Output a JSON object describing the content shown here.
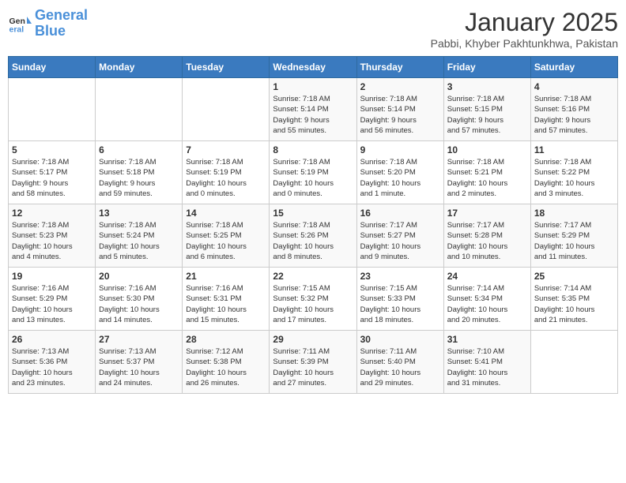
{
  "header": {
    "logo_line1": "General",
    "logo_line2": "Blue",
    "title": "January 2025",
    "subtitle": "Pabbi, Khyber Pakhtunkhwa, Pakistan"
  },
  "weekdays": [
    "Sunday",
    "Monday",
    "Tuesday",
    "Wednesday",
    "Thursday",
    "Friday",
    "Saturday"
  ],
  "weeks": [
    [
      {
        "day": "",
        "detail": ""
      },
      {
        "day": "",
        "detail": ""
      },
      {
        "day": "",
        "detail": ""
      },
      {
        "day": "1",
        "detail": "Sunrise: 7:18 AM\nSunset: 5:14 PM\nDaylight: 9 hours\nand 55 minutes."
      },
      {
        "day": "2",
        "detail": "Sunrise: 7:18 AM\nSunset: 5:14 PM\nDaylight: 9 hours\nand 56 minutes."
      },
      {
        "day": "3",
        "detail": "Sunrise: 7:18 AM\nSunset: 5:15 PM\nDaylight: 9 hours\nand 57 minutes."
      },
      {
        "day": "4",
        "detail": "Sunrise: 7:18 AM\nSunset: 5:16 PM\nDaylight: 9 hours\nand 57 minutes."
      }
    ],
    [
      {
        "day": "5",
        "detail": "Sunrise: 7:18 AM\nSunset: 5:17 PM\nDaylight: 9 hours\nand 58 minutes."
      },
      {
        "day": "6",
        "detail": "Sunrise: 7:18 AM\nSunset: 5:18 PM\nDaylight: 9 hours\nand 59 minutes."
      },
      {
        "day": "7",
        "detail": "Sunrise: 7:18 AM\nSunset: 5:19 PM\nDaylight: 10 hours\nand 0 minutes."
      },
      {
        "day": "8",
        "detail": "Sunrise: 7:18 AM\nSunset: 5:19 PM\nDaylight: 10 hours\nand 0 minutes."
      },
      {
        "day": "9",
        "detail": "Sunrise: 7:18 AM\nSunset: 5:20 PM\nDaylight: 10 hours\nand 1 minute."
      },
      {
        "day": "10",
        "detail": "Sunrise: 7:18 AM\nSunset: 5:21 PM\nDaylight: 10 hours\nand 2 minutes."
      },
      {
        "day": "11",
        "detail": "Sunrise: 7:18 AM\nSunset: 5:22 PM\nDaylight: 10 hours\nand 3 minutes."
      }
    ],
    [
      {
        "day": "12",
        "detail": "Sunrise: 7:18 AM\nSunset: 5:23 PM\nDaylight: 10 hours\nand 4 minutes."
      },
      {
        "day": "13",
        "detail": "Sunrise: 7:18 AM\nSunset: 5:24 PM\nDaylight: 10 hours\nand 5 minutes."
      },
      {
        "day": "14",
        "detail": "Sunrise: 7:18 AM\nSunset: 5:25 PM\nDaylight: 10 hours\nand 6 minutes."
      },
      {
        "day": "15",
        "detail": "Sunrise: 7:18 AM\nSunset: 5:26 PM\nDaylight: 10 hours\nand 8 minutes."
      },
      {
        "day": "16",
        "detail": "Sunrise: 7:17 AM\nSunset: 5:27 PM\nDaylight: 10 hours\nand 9 minutes."
      },
      {
        "day": "17",
        "detail": "Sunrise: 7:17 AM\nSunset: 5:28 PM\nDaylight: 10 hours\nand 10 minutes."
      },
      {
        "day": "18",
        "detail": "Sunrise: 7:17 AM\nSunset: 5:29 PM\nDaylight: 10 hours\nand 11 minutes."
      }
    ],
    [
      {
        "day": "19",
        "detail": "Sunrise: 7:16 AM\nSunset: 5:29 PM\nDaylight: 10 hours\nand 13 minutes."
      },
      {
        "day": "20",
        "detail": "Sunrise: 7:16 AM\nSunset: 5:30 PM\nDaylight: 10 hours\nand 14 minutes."
      },
      {
        "day": "21",
        "detail": "Sunrise: 7:16 AM\nSunset: 5:31 PM\nDaylight: 10 hours\nand 15 minutes."
      },
      {
        "day": "22",
        "detail": "Sunrise: 7:15 AM\nSunset: 5:32 PM\nDaylight: 10 hours\nand 17 minutes."
      },
      {
        "day": "23",
        "detail": "Sunrise: 7:15 AM\nSunset: 5:33 PM\nDaylight: 10 hours\nand 18 minutes."
      },
      {
        "day": "24",
        "detail": "Sunrise: 7:14 AM\nSunset: 5:34 PM\nDaylight: 10 hours\nand 20 minutes."
      },
      {
        "day": "25",
        "detail": "Sunrise: 7:14 AM\nSunset: 5:35 PM\nDaylight: 10 hours\nand 21 minutes."
      }
    ],
    [
      {
        "day": "26",
        "detail": "Sunrise: 7:13 AM\nSunset: 5:36 PM\nDaylight: 10 hours\nand 23 minutes."
      },
      {
        "day": "27",
        "detail": "Sunrise: 7:13 AM\nSunset: 5:37 PM\nDaylight: 10 hours\nand 24 minutes."
      },
      {
        "day": "28",
        "detail": "Sunrise: 7:12 AM\nSunset: 5:38 PM\nDaylight: 10 hours\nand 26 minutes."
      },
      {
        "day": "29",
        "detail": "Sunrise: 7:11 AM\nSunset: 5:39 PM\nDaylight: 10 hours\nand 27 minutes."
      },
      {
        "day": "30",
        "detail": "Sunrise: 7:11 AM\nSunset: 5:40 PM\nDaylight: 10 hours\nand 29 minutes."
      },
      {
        "day": "31",
        "detail": "Sunrise: 7:10 AM\nSunset: 5:41 PM\nDaylight: 10 hours\nand 31 minutes."
      },
      {
        "day": "",
        "detail": ""
      }
    ]
  ]
}
